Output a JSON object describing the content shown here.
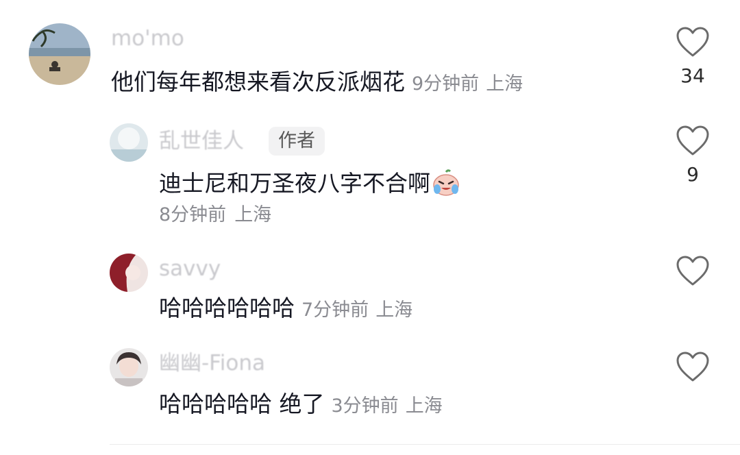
{
  "comments": [
    {
      "username": "mo'mo",
      "content": "他们每年都想来看次反派烟花",
      "time": "9分钟前",
      "location": "上海",
      "likes": "34"
    },
    {
      "username": "乱世佳人",
      "badge": "作者",
      "content": "迪士尼和万圣夜八字不合啊",
      "time": "8分钟前",
      "location": "上海",
      "likes": "9"
    },
    {
      "username": "savvy",
      "content": "哈哈哈哈哈哈",
      "time": "7分钟前",
      "location": "上海"
    },
    {
      "username": "幽幽-Fiona",
      "content": "哈哈哈哈哈 绝了",
      "time": "3分钟前",
      "location": "上海"
    }
  ],
  "icons": {
    "like": "heart-outline-icon",
    "emoji": "crying-laughing-emoji-icon"
  },
  "colors": {
    "username": "#c9c9cd",
    "content": "#161823",
    "meta": "#8a8b91",
    "heart": "#6b6b6b"
  }
}
